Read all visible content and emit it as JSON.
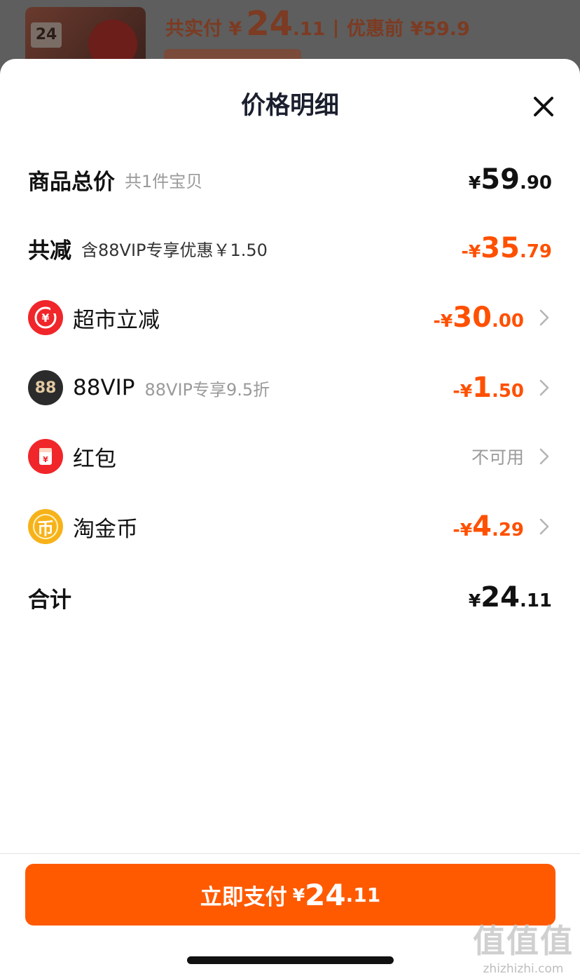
{
  "background": {
    "paid_label": "共实付 ¥",
    "paid_int": "24",
    "paid_dec": ".11",
    "original_label": "优惠前 ¥59.9",
    "thumb_text": "24"
  },
  "sheet": {
    "title": "价格明细"
  },
  "rows": {
    "subtotal": {
      "label": "商品总价",
      "sub": "共1件宝贝",
      "yen": "¥",
      "int": "59",
      "dec": ".90"
    },
    "discount": {
      "label": "共减",
      "sub": "含88VIP专享优惠￥1.50",
      "yen": "-¥",
      "int": "35",
      "dec": ".79"
    },
    "supermarket": {
      "label": "超市立减",
      "yen": "-¥",
      "int": "30",
      "dec": ".00"
    },
    "vip": {
      "label": "88VIP",
      "sub": "88VIP专享9.5折",
      "icon_text": "88",
      "yen": "-¥",
      "int": "1",
      "dec": ".50"
    },
    "redpacket": {
      "label": "红包",
      "status": "不可用"
    },
    "coins": {
      "label": "淘金币",
      "icon_text": "币",
      "yen": "-¥",
      "int": "4",
      "dec": ".29"
    },
    "total": {
      "label": "合计",
      "yen": "¥",
      "int": "24",
      "dec": ".11"
    }
  },
  "pay_button": {
    "label": "立即支付",
    "yen": "¥",
    "int": "24",
    "dec": ".11"
  },
  "watermark": {
    "mark": "值值值",
    "site": "zhizhizhi.com"
  },
  "colors": {
    "accent": "#ff5000",
    "button": "#ff5a00",
    "title": "#1b1f2e",
    "muted": "#9a9a9a"
  },
  "icons": {
    "close": "close-icon",
    "supermarket": "yen-refund-icon",
    "vip": "vip-88-icon",
    "redpacket": "red-envelope-icon",
    "coins": "gold-coin-icon",
    "chevron": "chevron-right-icon"
  }
}
